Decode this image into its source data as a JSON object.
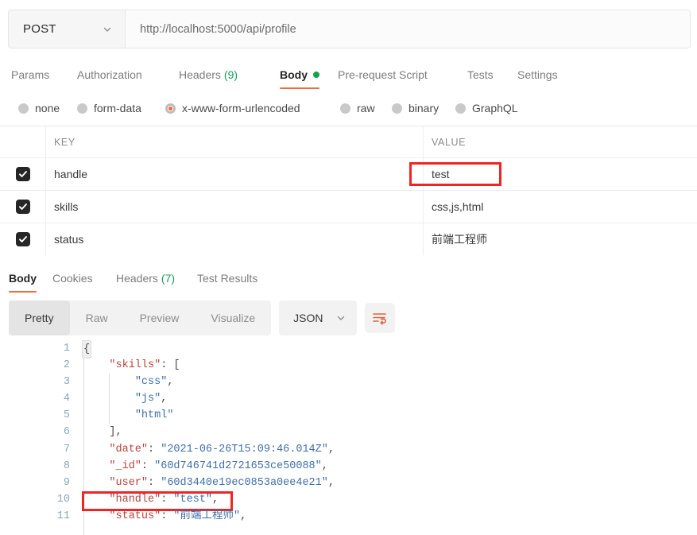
{
  "request": {
    "method": "POST",
    "url": "http://localhost:5000/api/profile",
    "tabs": [
      {
        "label": "Params",
        "count": "",
        "active": false
      },
      {
        "label": "Authorization",
        "count": "",
        "active": false
      },
      {
        "label": "Headers",
        "count": "(9)",
        "active": false
      },
      {
        "label": "Body",
        "count": "",
        "active": true,
        "dot": true
      },
      {
        "label": "Pre-request Script",
        "count": "",
        "active": false
      },
      {
        "label": "Tests",
        "count": "",
        "active": false
      },
      {
        "label": "Settings",
        "count": "",
        "active": false
      }
    ],
    "body_types": [
      {
        "label": "none",
        "selected": false
      },
      {
        "label": "form-data",
        "selected": false
      },
      {
        "label": "x-www-form-urlencoded",
        "selected": true
      },
      {
        "label": "raw",
        "selected": false
      },
      {
        "label": "binary",
        "selected": false
      },
      {
        "label": "GraphQL",
        "selected": false
      }
    ],
    "table": {
      "columns": [
        "KEY",
        "VALUE"
      ],
      "rows": [
        {
          "checked": true,
          "key": "handle",
          "value": "test",
          "highlight": true
        },
        {
          "checked": true,
          "key": "skills",
          "value": "css,js,html",
          "highlight": false
        },
        {
          "checked": true,
          "key": "status",
          "value": "前端工程师",
          "highlight": false
        }
      ]
    }
  },
  "response": {
    "tabs": [
      {
        "label": "Body",
        "count": "",
        "active": true
      },
      {
        "label": "Cookies",
        "count": "",
        "active": false
      },
      {
        "label": "Headers",
        "count": "(7)",
        "active": false
      },
      {
        "label": "Test Results",
        "count": "",
        "active": false
      }
    ],
    "view_modes": [
      {
        "label": "Pretty",
        "active": true
      },
      {
        "label": "Raw",
        "active": false
      },
      {
        "label": "Preview",
        "active": false
      },
      {
        "label": "Visualize",
        "active": false
      }
    ],
    "format": "JSON",
    "wrap_icon": "word-wrap-icon",
    "json_lines": [
      {
        "n": "1",
        "indent": 0,
        "segments": [
          {
            "t": "{",
            "c": "p",
            "brace": true
          }
        ]
      },
      {
        "n": "2",
        "indent": 0,
        "segments": [
          {
            "t": "    ",
            "c": "p"
          },
          {
            "t": "\"skills\"",
            "c": "k"
          },
          {
            "t": ": [",
            "c": "p"
          }
        ]
      },
      {
        "n": "3",
        "indent": 1,
        "segments": [
          {
            "t": "        ",
            "c": "p"
          },
          {
            "t": "\"css\"",
            "c": "v"
          },
          {
            "t": ",",
            "c": "p"
          }
        ]
      },
      {
        "n": "4",
        "indent": 1,
        "segments": [
          {
            "t": "        ",
            "c": "p"
          },
          {
            "t": "\"js\"",
            "c": "v"
          },
          {
            "t": ",",
            "c": "p"
          }
        ]
      },
      {
        "n": "5",
        "indent": 1,
        "segments": [
          {
            "t": "        ",
            "c": "p"
          },
          {
            "t": "\"html\"",
            "c": "v"
          }
        ]
      },
      {
        "n": "6",
        "indent": 0,
        "segments": [
          {
            "t": "    ],",
            "c": "p"
          }
        ]
      },
      {
        "n": "7",
        "indent": 0,
        "segments": [
          {
            "t": "    ",
            "c": "p"
          },
          {
            "t": "\"date\"",
            "c": "k"
          },
          {
            "t": ": ",
            "c": "p"
          },
          {
            "t": "\"2021-06-26T15:09:46.014Z\"",
            "c": "v"
          },
          {
            "t": ",",
            "c": "p"
          }
        ]
      },
      {
        "n": "8",
        "indent": 0,
        "segments": [
          {
            "t": "    ",
            "c": "p"
          },
          {
            "t": "\"_id\"",
            "c": "k"
          },
          {
            "t": ": ",
            "c": "p"
          },
          {
            "t": "\"60d746741d2721653ce50088\"",
            "c": "v"
          },
          {
            "t": ",",
            "c": "p"
          }
        ]
      },
      {
        "n": "9",
        "indent": 0,
        "segments": [
          {
            "t": "    ",
            "c": "p"
          },
          {
            "t": "\"user\"",
            "c": "k"
          },
          {
            "t": ": ",
            "c": "p"
          },
          {
            "t": "\"60d3440e19ec0853a0ee4e21\"",
            "c": "v"
          },
          {
            "t": ",",
            "c": "p"
          }
        ]
      },
      {
        "n": "10",
        "indent": 0,
        "highlight": true,
        "segments": [
          {
            "t": "    ",
            "c": "p"
          },
          {
            "t": "\"handle\"",
            "c": "k"
          },
          {
            "t": ": ",
            "c": "p"
          },
          {
            "t": "\"test\"",
            "c": "v"
          },
          {
            "t": ",",
            "c": "p"
          }
        ]
      },
      {
        "n": "11",
        "indent": 0,
        "segments": [
          {
            "t": "    ",
            "c": "p"
          },
          {
            "t": "\"status\"",
            "c": "k"
          },
          {
            "t": ": ",
            "c": "p"
          },
          {
            "t": "\"前端工程师\"",
            "c": "v"
          },
          {
            "t": ",",
            "c": "p"
          }
        ]
      }
    ]
  },
  "colors": {
    "accent_orange": "#ef6c3f",
    "radio_selected": "#f26b37",
    "green_dot": "#16a34a",
    "count_green": "#159e5a",
    "highlight_red": "#ef2424",
    "json_key": "#b5443f",
    "json_string": "#3f6fa8",
    "line_number": "#8fa6b4"
  }
}
